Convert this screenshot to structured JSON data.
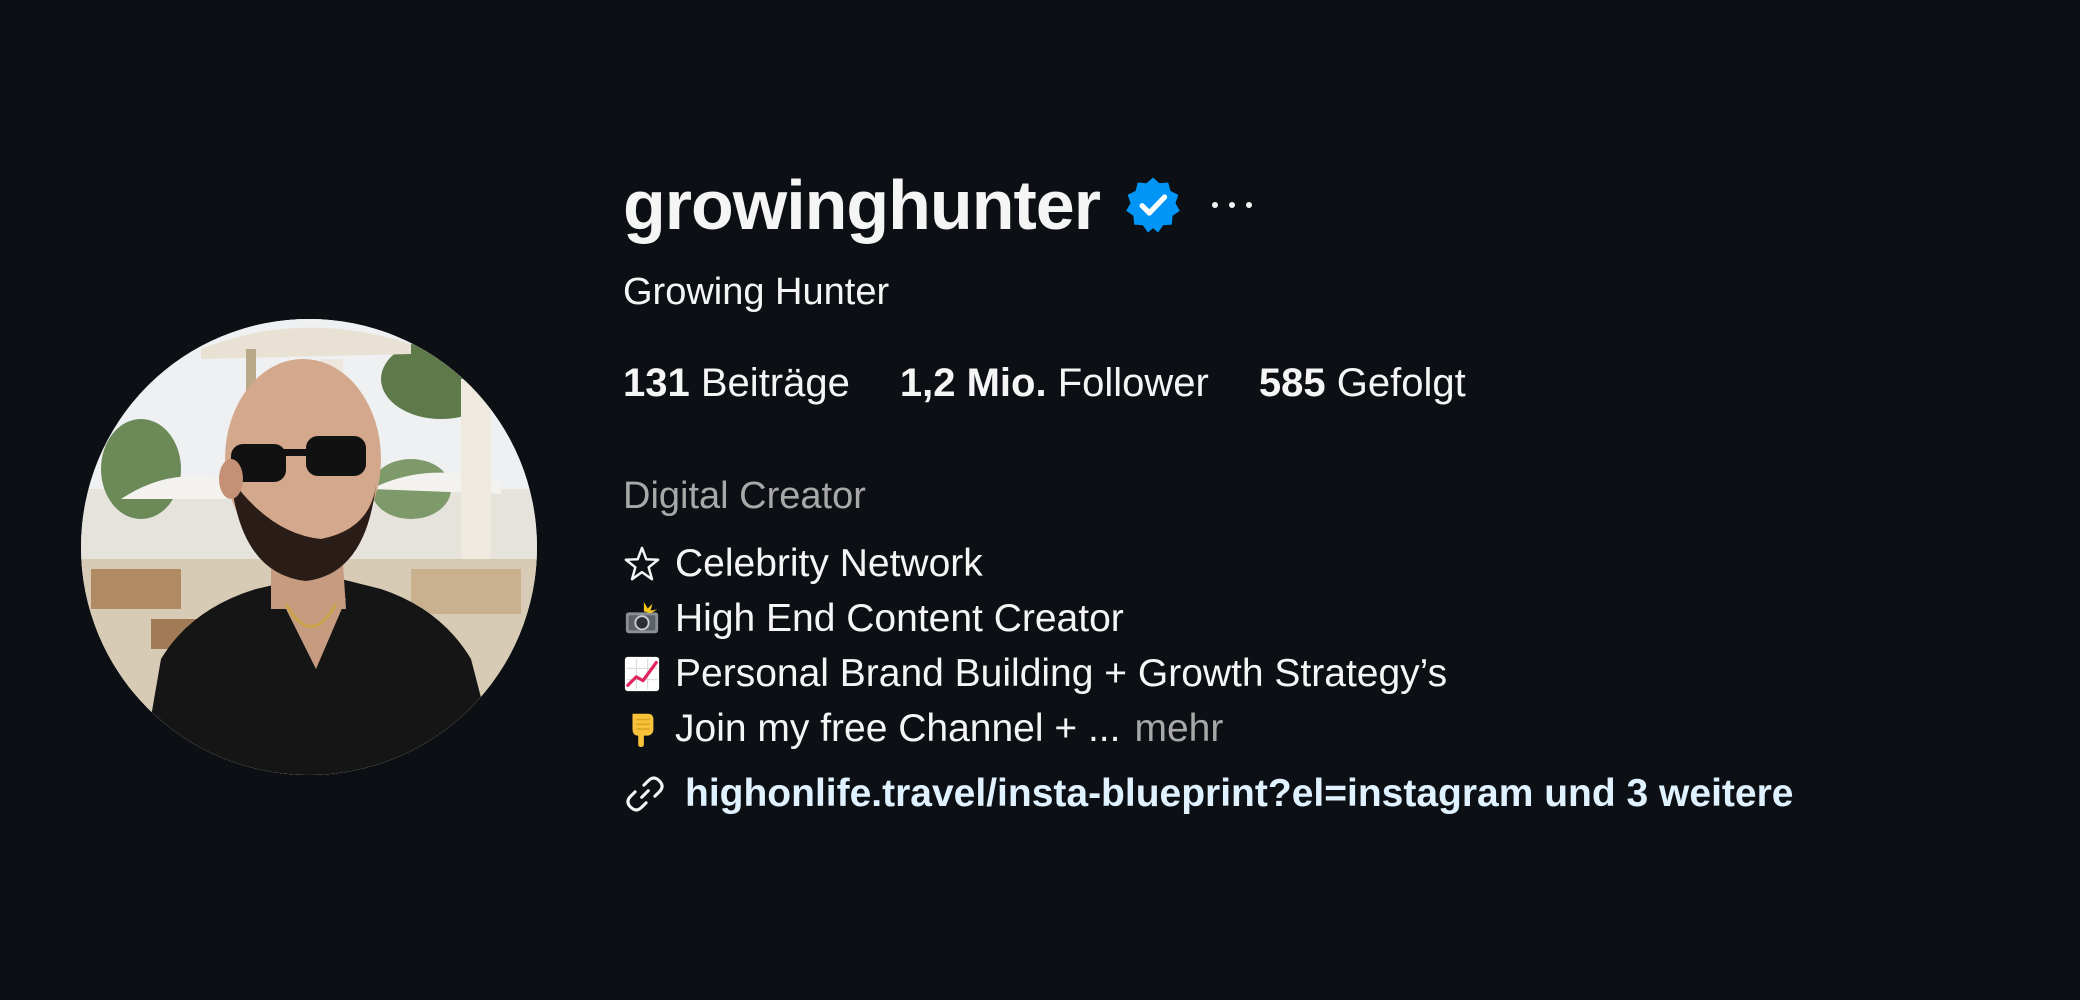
{
  "profile": {
    "username": "growinghunter",
    "full_name": "Growing Hunter",
    "verified": true,
    "stats": {
      "posts_value": "131",
      "posts_label": "Beiträge",
      "followers_value": "1,2 Mio.",
      "followers_label": "Follower",
      "following_value": "585",
      "following_label": "Gefolgt"
    },
    "category": "Digital Creator",
    "bio": [
      {
        "icon": "star-icon",
        "text": "Celebrity Network"
      },
      {
        "icon": "camera-flash-icon",
        "text": "High End Content Creator"
      },
      {
        "icon": "chart-increasing-icon",
        "text": "Personal Brand Building + Growth Strategy’s"
      },
      {
        "icon": "pointing-down-icon",
        "text": "Join my free Channel + ..."
      }
    ],
    "more_label": "mehr",
    "link_text": "highonlife.travel/insta-blueprint?el=instagram und 3 weitere"
  },
  "colors": {
    "background": "#0c1014",
    "verified_badge": "#0095f6",
    "secondary_text": "#a8a8a8"
  }
}
